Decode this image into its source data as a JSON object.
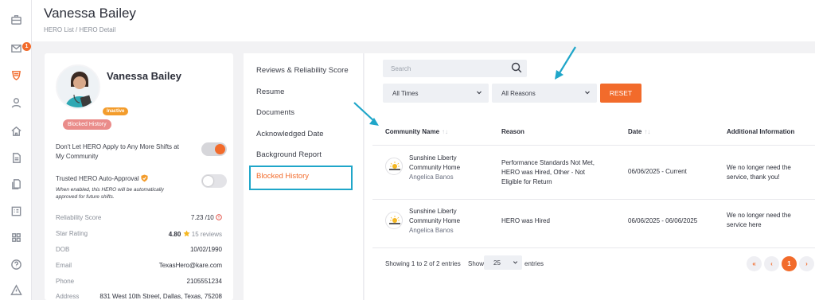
{
  "sidebar": {
    "icons": [
      "briefcase-icon",
      "mail-icon",
      "hero-shield-icon",
      "person-icon",
      "home-icon",
      "document-icon",
      "files-icon",
      "checklist-icon",
      "grid-icon",
      "help-icon",
      "warning-icon"
    ],
    "mail_badge": "1",
    "active": "hero-shield-icon"
  },
  "header": {
    "title": "Vanessa Bailey",
    "breadcrumb": "HERO List / HERO Detail"
  },
  "profile": {
    "name": "Vanessa Bailey",
    "status_tag": "Inactive",
    "blocked_tag": "Blocked History",
    "setting_apply": "Don't Let HERO Apply to Any More Shifts at My Community",
    "setting_trusted": "Trusted HERO Auto-Approval",
    "trusted_helper": "When enabled, this HERO will be automatically approved for future shifts.",
    "fields": {
      "reliability_label": "Reliability Score",
      "reliability_value": "7.23 /10",
      "star_label": "Star Rating",
      "star_value": "4.80",
      "star_reviews": "15 reviews",
      "dob_label": "DOB",
      "dob_value": "10/02/1990",
      "email_label": "Email",
      "email_value": "TexasHero@kare.com",
      "phone_label": "Phone",
      "phone_value": "2105551234",
      "address_label": "Address",
      "address_value": "831 West 10th Street, Dallas, Texas, 75208"
    },
    "colors": {
      "accent": "#f26b2b",
      "inactive": "#f39c2b",
      "blocked": "#ea8c8a"
    }
  },
  "detail_nav": {
    "items": [
      "Reviews & Reliability Score",
      "Resume",
      "Documents",
      "Acknowledged Date",
      "Background Report",
      "Blocked History"
    ],
    "active": "Blocked History",
    "highlight_color": "#1fa6c9"
  },
  "filters": {
    "search_placeholder": "Search",
    "time_value": "All Times",
    "reason_value": "All Reasons",
    "reset_label": "RESET"
  },
  "table": {
    "columns": [
      "Community Name",
      "Reason",
      "Date",
      "Additional Information"
    ],
    "rows": [
      {
        "community_line1": "Sunshine Liberty",
        "community_line2": "Community Home",
        "contact": "Angelica Banos",
        "reason_lines": [
          "Performance Standards Not Met,",
          "HERO was Hired, Other - Not",
          "Eligible for Return"
        ],
        "date": "06/06/2025 - Current",
        "info_lines": [
          "We no longer need the",
          "service, thank you!"
        ]
      },
      {
        "community_line1": "Sunshine Liberty",
        "community_line2": "Community Home",
        "contact": "Angelica Banos",
        "reason_lines": [
          "HERO was Hired"
        ],
        "date": "06/06/2025 - 06/06/2025",
        "info_lines": [
          "We no longer need the",
          "service here"
        ]
      }
    ]
  },
  "pagination": {
    "info": "Showing 1 to 2 of 2 entries",
    "show_label": "Show",
    "page_size": "25",
    "entries_label": "entries",
    "first": "«",
    "prev": "‹",
    "current": "1",
    "next": "›"
  }
}
